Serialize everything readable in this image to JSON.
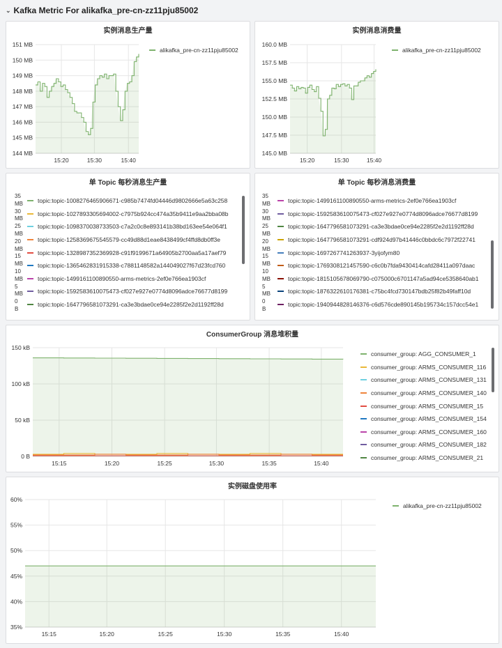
{
  "row": {
    "title": "Kafka Metric For alikafka_pre-cn-zz11pju85002",
    "chevron": "chevron-down-icon"
  },
  "panel1": {
    "title": "实例消息生产量",
    "y_ticks": [
      "151 MB",
      "150 MB",
      "149 MB",
      "148 MB",
      "147 MB",
      "146 MB",
      "145 MB",
      "144 MB"
    ],
    "x_ticks": [
      "15:20",
      "15:30",
      "15:40"
    ],
    "legend": [
      {
        "label": "alikafka_pre-cn-zz11pju85002",
        "color": "#7eb26d"
      }
    ]
  },
  "panel2": {
    "title": "实例消息消费量",
    "y_ticks": [
      "160.0 MB",
      "157.5 MB",
      "155.0 MB",
      "152.5 MB",
      "150.0 MB",
      "147.5 MB",
      "145.0 MB"
    ],
    "x_ticks": [
      "15:20",
      "15:30",
      "15:40"
    ],
    "legend": [
      {
        "label": "alikafka_pre-cn-zz11pju85002",
        "color": "#7eb26d"
      }
    ]
  },
  "panel3": {
    "title": "单 Topic 每秒消息生产量",
    "y_labels": [
      "35",
      "MB",
      "30",
      "MB",
      "25",
      "MB",
      "20",
      "MB",
      "15",
      "MB",
      "10",
      "MB",
      "5",
      "MB",
      "0",
      "B"
    ],
    "legend": [
      {
        "label": "topic:topic-1008276465906671-c985b7474fd04446d9802666e5a63c258",
        "color": "#7eb26d"
      },
      {
        "label": "topic:topic-1027893305694002-c7975b924cc474a35b9411e9aa2bba08b",
        "color": "#eab839"
      },
      {
        "label": "topic:topic-1098370038733503-c7a2c0c8e893141b38bd163ee54e064f1",
        "color": "#6ed0e0"
      },
      {
        "label": "topic:topic-1258369675545579-cc49d88d1eae8438499cf4ffd8db0ff3e",
        "color": "#ef843c"
      },
      {
        "label": "topic:topic-1328987352369928-c91f9199671a64905b2700aa5a17aef79",
        "color": "#e24d42"
      },
      {
        "label": "topic:topic-1365462831915338-c7881148582a144049027f67d23fcd760",
        "color": "#1f78c1"
      },
      {
        "label": "topic:topic-1499161100890550-arms-metrics-2ef0e766ea1903cf",
        "color": "#ba43a9"
      },
      {
        "label": "topic:topic-1592583610075473-cf027e927e0774d8096adce76677d8199",
        "color": "#705da0"
      },
      {
        "label": "topic:topic-1647796581073291-ca3e3bdae0ce94e2285f2e2d1192ff28d",
        "color": "#508642"
      }
    ]
  },
  "panel4": {
    "title": "单 Topic 每秒消息消费量",
    "y_labels": [
      "35",
      "MB",
      "30",
      "MB",
      "25",
      "MB",
      "20",
      "MB",
      "15",
      "MB",
      "10",
      "MB",
      "5",
      "MB",
      "0",
      "B"
    ],
    "legend": [
      {
        "label": "topic:topic-1499161100890550-arms-metrics-2ef0e766ea1903cf",
        "color": "#ba43a9"
      },
      {
        "label": "topic:topic-1592583610075473-cf027e927e0774d8096adce76677d8199",
        "color": "#705da0"
      },
      {
        "label": "topic:topic-1647796581073291-ca3e3bdae0ce94e2285f2e2d1192ff28d",
        "color": "#508642"
      },
      {
        "label": "topic:topic-1647796581073291-cdf924d97b41446c0bbdc6c7972f22741",
        "color": "#cca300"
      },
      {
        "label": "topic:topic-1697267741263937-3yijofym80",
        "color": "#447ebc"
      },
      {
        "label": "topic:topic-1769308121457590-c6c0b7fda9430414cafd28411a097daac",
        "color": "#c15c17"
      },
      {
        "label": "topic:topic-1815105678069790-c075000c6701147a5ad94ce5358640ab1",
        "color": "#890f02"
      },
      {
        "label": "topic:topic-1876322610176381-c75bc4fcd730147bdb25f82b49faff10d",
        "color": "#0a437c"
      },
      {
        "label": "topic:topic-1940944828146376-c6d576cde890145b195734c157dcc54e1",
        "color": "#6d1f62"
      }
    ]
  },
  "panel5": {
    "title": "ConsumerGroup 消息堆积量",
    "y_ticks": [
      "150 kB",
      "100 kB",
      "50 kB",
      "0 B"
    ],
    "x_ticks": [
      "15:15",
      "15:20",
      "15:25",
      "15:30",
      "15:35",
      "15:40"
    ],
    "legend": [
      {
        "label": "consumer_group: AGG_CONSUMER_1",
        "color": "#7eb26d"
      },
      {
        "label": "consumer_group: ARMS_CONSUMER_116",
        "color": "#eab839"
      },
      {
        "label": "consumer_group: ARMS_CONSUMER_131",
        "color": "#6ed0e0"
      },
      {
        "label": "consumer_group: ARMS_CONSUMER_140",
        "color": "#ef843c"
      },
      {
        "label": "consumer_group: ARMS_CONSUMER_15",
        "color": "#e24d42"
      },
      {
        "label": "consumer_group: ARMS_CONSUMER_154",
        "color": "#1f78c1"
      },
      {
        "label": "consumer_group: ARMS_CONSUMER_160",
        "color": "#ba43a9"
      },
      {
        "label": "consumer_group: ARMS_CONSUMER_182",
        "color": "#705da0"
      },
      {
        "label": "consumer_group: ARMS_CONSUMER_21",
        "color": "#508642"
      }
    ]
  },
  "panel6": {
    "title": "实例磁盘使用率",
    "y_ticks": [
      "60%",
      "55%",
      "50%",
      "45%",
      "40%",
      "35%"
    ],
    "x_ticks": [
      "15:15",
      "15:20",
      "15:25",
      "15:30",
      "15:35",
      "15:40"
    ],
    "legend": [
      {
        "label": "alikafka_pre-cn-zz11pju85002",
        "color": "#7eb26d"
      }
    ]
  },
  "chart_data": [
    {
      "type": "area",
      "title": "实例消息生产量",
      "ylim_label": [
        "144 MB",
        "151 MB"
      ],
      "ylim": [
        144,
        151
      ],
      "x_label_ticks": [
        "15:20",
        "15:30",
        "15:40"
      ],
      "series": [
        {
          "name": "alikafka_pre-cn-zz11pju85002",
          "unit": "MB",
          "values": [
            148.4,
            148.6,
            148.0,
            148.5,
            148.3,
            147.6,
            148.0,
            148.3,
            148.5,
            148.8,
            148.6,
            148.3,
            148.4,
            148.1,
            147.9,
            147.6,
            147.2,
            146.7,
            146.6,
            146.6,
            146.3,
            146.0,
            145.4,
            145.2,
            145.6,
            147.3,
            148.4,
            148.8,
            149.0,
            148.9,
            149.1,
            148.8,
            149.0,
            149.0,
            149.1,
            148.0,
            147.0,
            146.1,
            146.8,
            148.0,
            148.5,
            148.6,
            149.0,
            149.9,
            150.2,
            150.4
          ]
        }
      ]
    },
    {
      "type": "area",
      "title": "实例消息消费量",
      "ylim": [
        145,
        160
      ],
      "x_label_ticks": [
        "15:20",
        "15:30",
        "15:40"
      ],
      "series": [
        {
          "name": "alikafka_pre-cn-zz11pju85002",
          "unit": "MB",
          "values": [
            154.4,
            154.0,
            153.6,
            154.2,
            153.9,
            154.1,
            154.0,
            153.3,
            154.1,
            154.4,
            153.8,
            153.5,
            154.2,
            152.6,
            150.8,
            147.4,
            148.3,
            152.5,
            153.0,
            154.0,
            153.9,
            154.5,
            154.2,
            154.5,
            154.6,
            154.3,
            154.5,
            154.0,
            152.4,
            154.3,
            154.3,
            154.8,
            155.0,
            155.0,
            155.4,
            155.7,
            155.5,
            156.0,
            156.3,
            156.6
          ]
        }
      ]
    },
    {
      "type": "line",
      "title": "ConsumerGroup 消息堆积量",
      "ylim": [
        0,
        150
      ],
      "unit": "kB",
      "x_label_ticks": [
        "15:15",
        "15:20",
        "15:25",
        "15:30",
        "15:35",
        "15:40"
      ],
      "series": [
        {
          "name": "consumer_group: AGG_CONSUMER_1",
          "values": [
            136,
            135.8,
            135.6,
            135.4,
            135.2,
            135,
            134.8,
            134.6,
            134.4,
            134.2,
            134
          ]
        },
        {
          "name": "consumer_group: ARMS_CONSUMER_116",
          "values": [
            3,
            4,
            3,
            3,
            4,
            3,
            3,
            4,
            3,
            3,
            3
          ]
        },
        {
          "name": "consumer_group: ARMS_CONSUMER_140",
          "values": [
            2,
            2,
            3,
            2,
            2,
            3,
            2,
            2,
            3,
            2,
            2
          ]
        },
        {
          "name": "consumer_group: ARMS_CONSUMER_15",
          "values": [
            1,
            1,
            1,
            1,
            1,
            1,
            1,
            1,
            1,
            1,
            1
          ]
        }
      ]
    },
    {
      "type": "line",
      "title": "实例磁盘使用率",
      "ylim": [
        35,
        60
      ],
      "unit": "%",
      "x_label_ticks": [
        "15:15",
        "15:20",
        "15:25",
        "15:30",
        "15:35",
        "15:40"
      ],
      "series": [
        {
          "name": "alikafka_pre-cn-zz11pju85002",
          "values": [
            47,
            47,
            47,
            47,
            47,
            47,
            47,
            47,
            47,
            47,
            47
          ]
        }
      ]
    }
  ]
}
